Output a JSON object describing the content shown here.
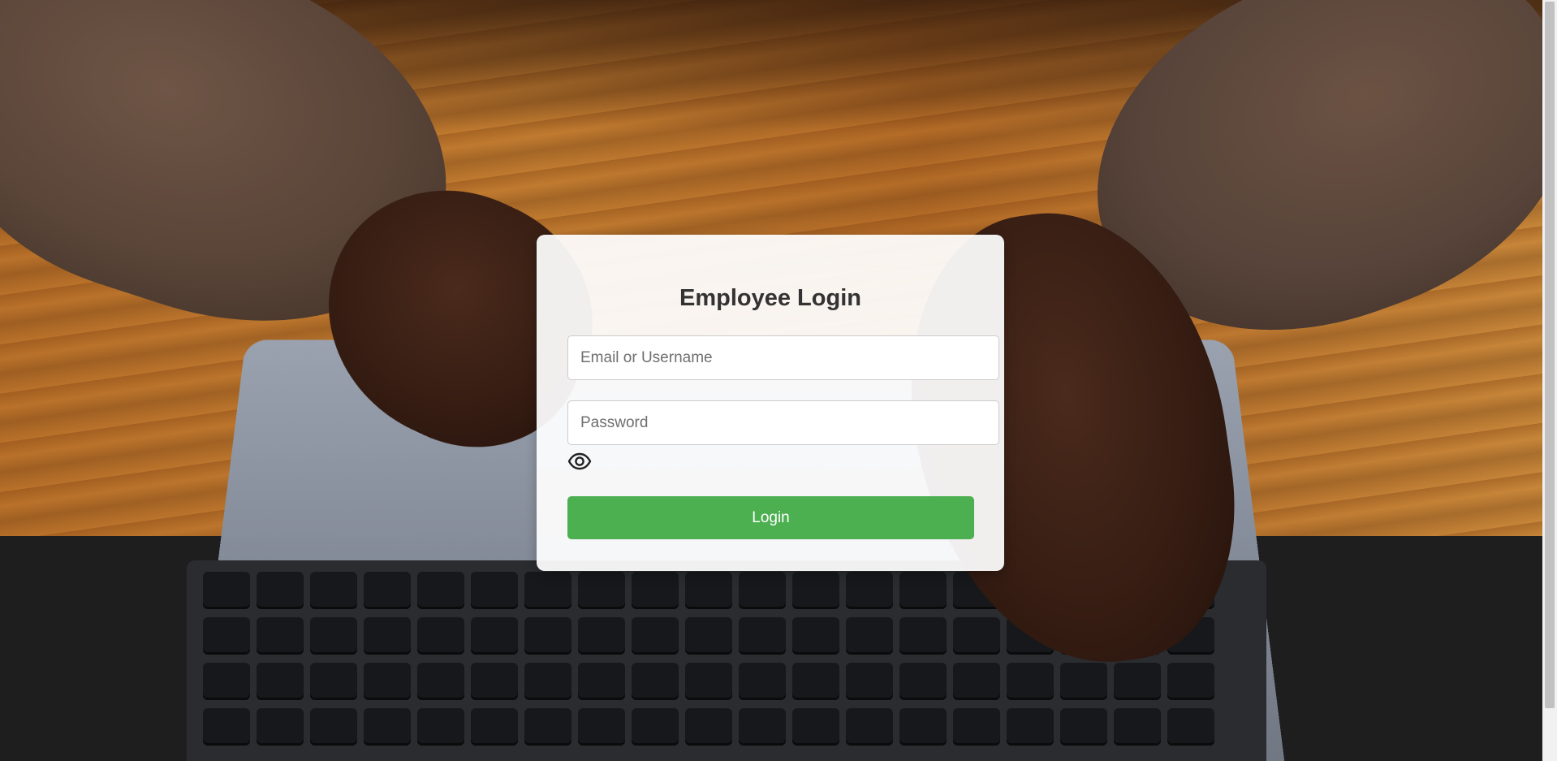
{
  "login": {
    "title": "Employee Login",
    "username_placeholder": "Email or Username",
    "password_placeholder": "Password",
    "show_password_icon": "eye-icon",
    "submit_label": "Login"
  },
  "colors": {
    "accent": "#4caf50",
    "card_background": "#ffffff",
    "title_text": "#333333"
  }
}
